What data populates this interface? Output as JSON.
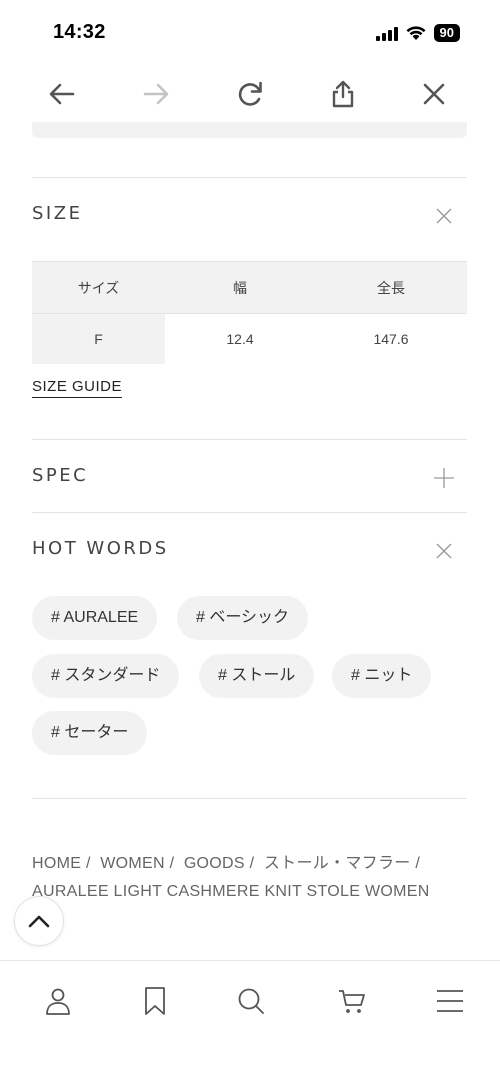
{
  "status_bar": {
    "time": "14:32",
    "battery": "90",
    "icons": [
      "signal-icon",
      "wifi-icon",
      "battery-icon"
    ]
  },
  "browser_toolbar": {
    "icons": [
      "back-arrow-icon",
      "forward-arrow-icon",
      "reload-icon",
      "share-icon",
      "close-icon"
    ]
  },
  "size_section": {
    "title": "SIZE",
    "toggle_icon": "close-x-icon",
    "table": {
      "headers": [
        "サイズ",
        "幅",
        "全長"
      ],
      "rows": [
        [
          "F",
          "12.4",
          "147.6"
        ]
      ]
    },
    "size_guide_label": "SIZE GUIDE"
  },
  "spec_section": {
    "title": "SPEC",
    "toggle_icon": "plus-icon"
  },
  "hot_words_section": {
    "title": "HOT WORDS",
    "toggle_icon": "close-x-icon",
    "tags": [
      "# AURALEE",
      "# ベーシック",
      "# スタンダード",
      "# ストール",
      "# ニット",
      "# セーター"
    ]
  },
  "breadcrumb": {
    "items": [
      "HOME",
      "WOMEN",
      "GOODS",
      "ストール・マフラー",
      "AURALEE LIGHT CASHMERE KNIT STOLE WOMEN"
    ],
    "separator": "/"
  },
  "scroll_top_icon": "chevron-up-icon",
  "bottom_nav": {
    "icons": [
      "account-icon",
      "bookmark-icon",
      "search-icon",
      "cart-icon",
      "menu-icon"
    ]
  },
  "colors": {
    "text": "#444444",
    "pill_bg": "#f2f2f2",
    "divider": "#e4e4e4"
  }
}
